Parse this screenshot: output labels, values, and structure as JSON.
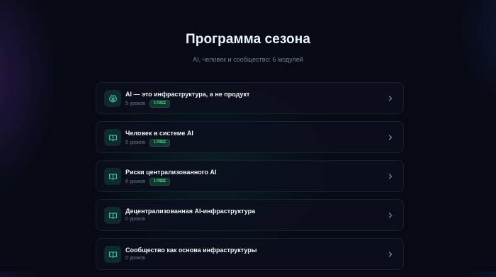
{
  "header": {
    "title": "Программа сезона",
    "subtitle": "AI, человек и сообщество: 6 модулей"
  },
  "modules": [
    {
      "title": "AI — это инфраструктура, а не продукт",
      "lessons": "5 уроков",
      "badge": "3 FREE",
      "icon": "brain-icon"
    },
    {
      "title": "Человек в системе AI",
      "lessons": "5 уроков",
      "badge": "1 FREE",
      "icon": "book-icon"
    },
    {
      "title": "Риски централизованного AI",
      "lessons": "6 уроков",
      "badge": "1 FREE",
      "icon": "book-icon"
    },
    {
      "title": "Децентрализованная AI-инфраструктура",
      "lessons": "0 уроков",
      "badge": "",
      "icon": "book-icon"
    },
    {
      "title": "Сообщество как основа инфраструктуры",
      "lessons": "0 уроков",
      "badge": "",
      "icon": "book-icon"
    }
  ],
  "colors": {
    "accent": "#48e2a0",
    "icon": "#3fd0b0",
    "background": "#070a15"
  }
}
